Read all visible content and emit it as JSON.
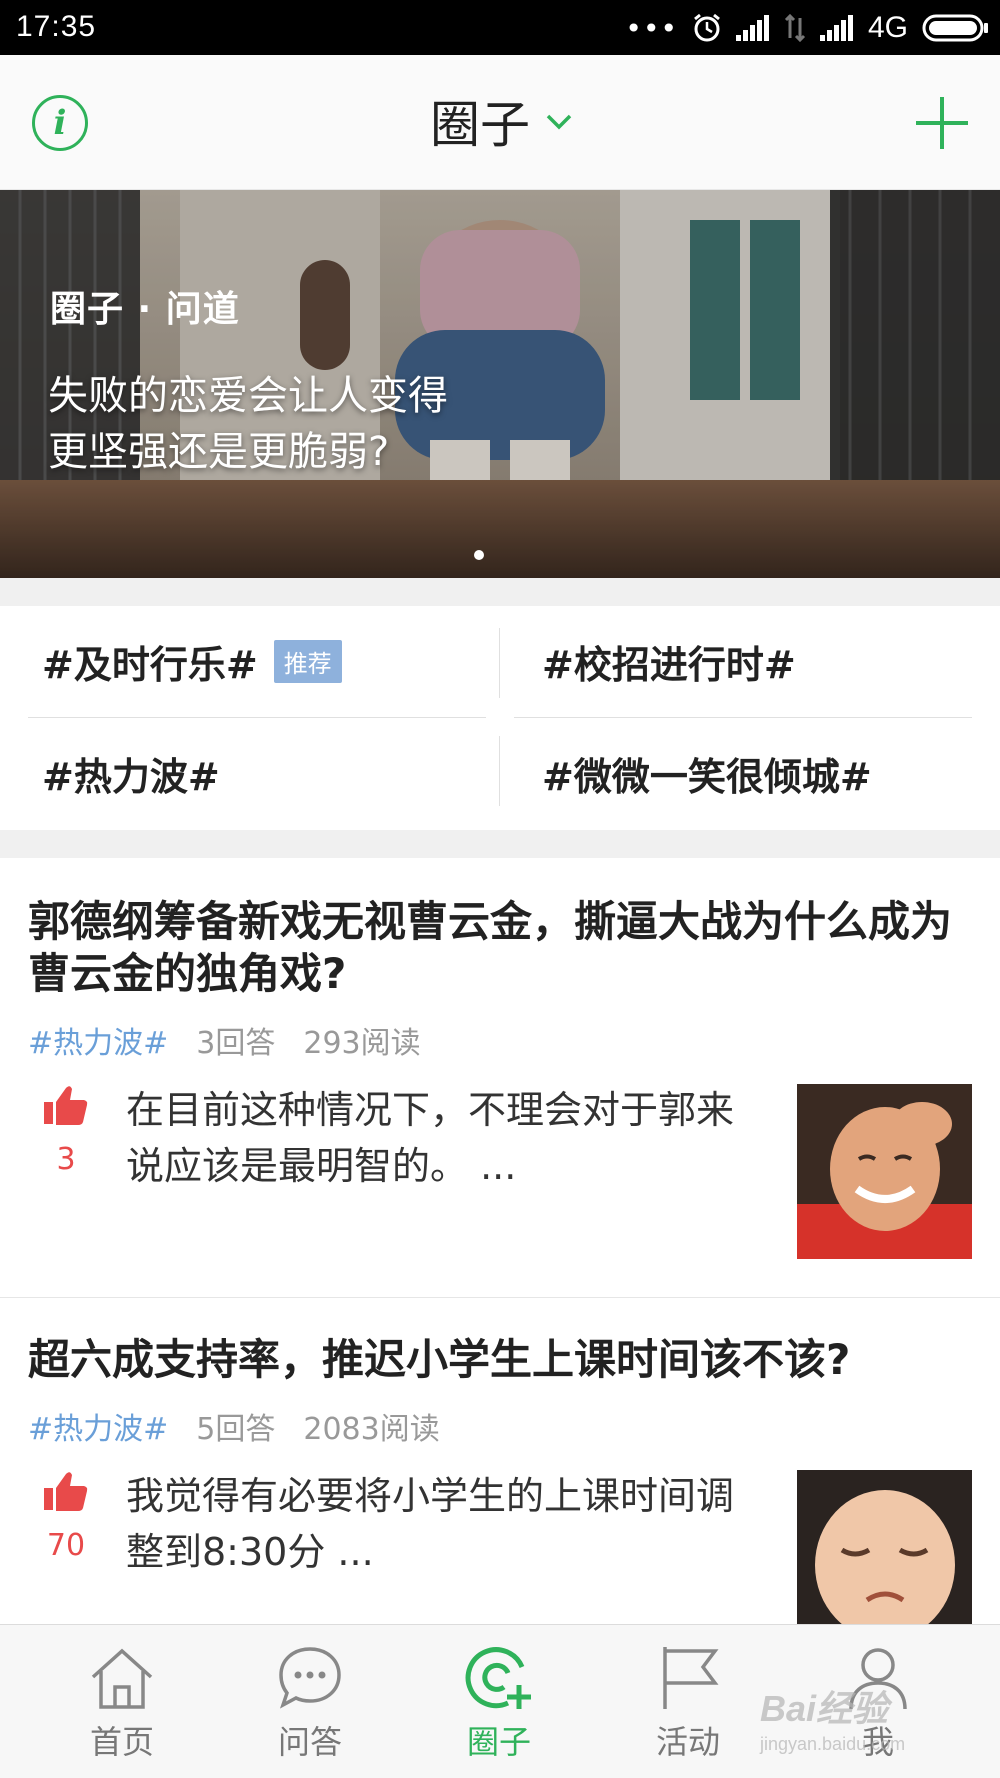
{
  "status_bar": {
    "time": "17:35",
    "dots": "•••",
    "network": "4G"
  },
  "header": {
    "title": "圈子"
  },
  "banner": {
    "logo_text": "圈子 · 问道",
    "headline_line1": "失败的恋爱会让人变得",
    "headline_line2": "更坚强还是更脆弱?"
  },
  "topics": [
    {
      "label": "#及时行乐#",
      "badge": "推荐"
    },
    {
      "label": "#校招进行时#"
    },
    {
      "label": "#热力波#"
    },
    {
      "label": "#微微一笑很倾城#"
    }
  ],
  "feed": [
    {
      "title": "郭德纲筹备新戏无视曹云金，撕逼大战为什么成为曹云金的独角戏?",
      "tag": "#热力波#",
      "answers": "3回答",
      "reads": "293阅读",
      "likes": "3",
      "answer_preview": "在目前这种情况下，不理会对于郭来说应该是最明智的。 ..."
    },
    {
      "title": "超六成支持率，推迟小学生上课时间该不该?",
      "tag": "#热力波#",
      "answers": "5回答",
      "reads": "2083阅读",
      "likes": "70",
      "answer_preview": "我觉得有必要将小学生的上课时间调整到8:30分 ..."
    }
  ],
  "tabbar": [
    {
      "label": "首页",
      "icon": "home-icon"
    },
    {
      "label": "问答",
      "icon": "chat-bubble-icon"
    },
    {
      "label": "圈子",
      "icon": "circle-plus-icon",
      "active": true
    },
    {
      "label": "活动",
      "icon": "flag-icon"
    },
    {
      "label": "我",
      "icon": "person-icon"
    }
  ],
  "watermark": {
    "brand": "Bai",
    "brand2": "经验",
    "url": "jingyan.baidu.com"
  },
  "colors": {
    "accent_green": "#2fb25a",
    "tag_blue": "#6a9fd8",
    "like_red": "#e84a4a",
    "badge_blue": "#8eb1dc"
  }
}
